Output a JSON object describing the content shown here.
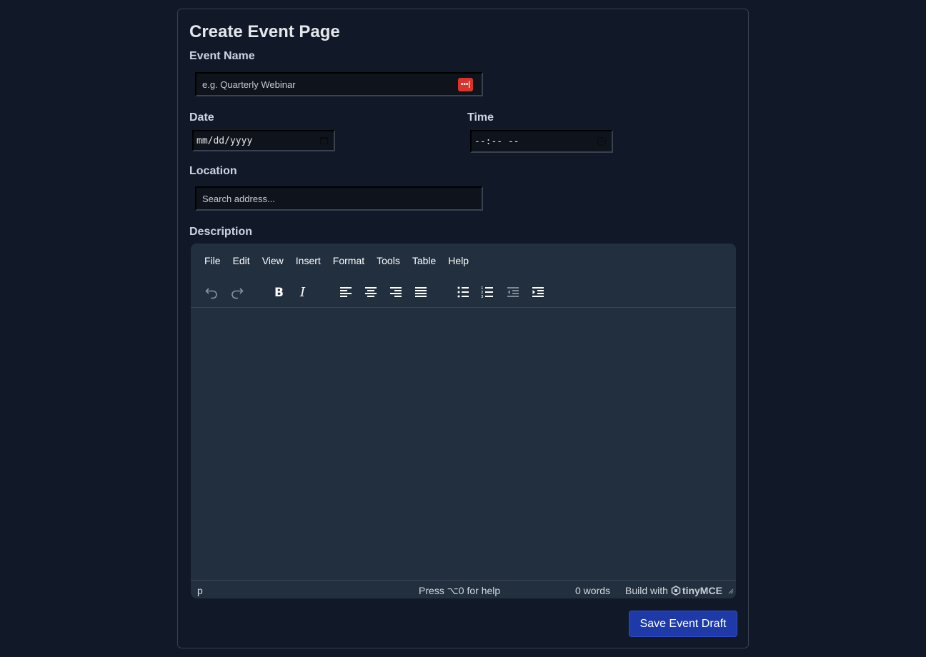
{
  "page": {
    "title": "Create Event Page"
  },
  "form": {
    "event_name": {
      "label": "Event Name",
      "placeholder": "e.g. Quarterly Webinar",
      "value": ""
    },
    "date": {
      "label": "Date",
      "placeholder": "mm/dd/yyyy"
    },
    "time": {
      "label": "Time",
      "placeholder": "--:-- --"
    },
    "location": {
      "label": "Location",
      "placeholder": "Search address..."
    },
    "description": {
      "label": "Description"
    }
  },
  "editor": {
    "menu": [
      "File",
      "Edit",
      "View",
      "Insert",
      "Format",
      "Tools",
      "Table",
      "Help"
    ],
    "toolbar_icons": [
      "undo-icon",
      "redo-icon",
      "bold-icon",
      "italic-icon",
      "align-left-icon",
      "align-center-icon",
      "align-right-icon",
      "align-justify-icon",
      "bullet-list-icon",
      "numbered-list-icon",
      "outdent-icon",
      "indent-icon"
    ],
    "status": {
      "path": "p",
      "help": "Press ⌥0 for help",
      "words": "0 words",
      "brand_prefix": "Build with",
      "brand_name": "tinyMCE"
    }
  },
  "actions": {
    "save_label": "Save Event Draft"
  },
  "colors": {
    "accent": "#1e3aa8",
    "background": "#111827",
    "editor_bg": "#222f3e",
    "password_badge": "#d9342b"
  }
}
